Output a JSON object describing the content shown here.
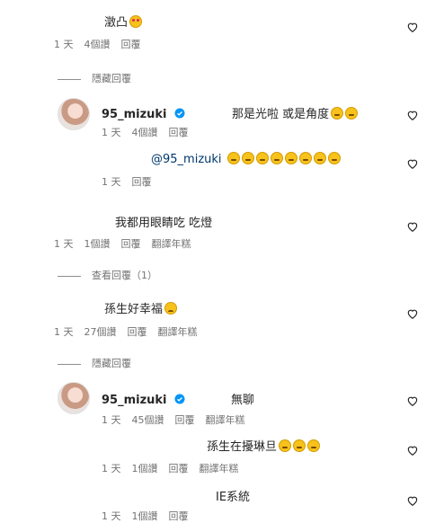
{
  "comments": [
    {
      "text": "澂凸",
      "time": "1 天",
      "likes": "4個讚",
      "reply": "回覆"
    },
    {
      "toggle": "隱藏回覆"
    },
    {
      "username": "95_mizuki",
      "text": "那是光啦 或是角度",
      "time": "1 天",
      "likes": "4個讚",
      "reply": "回覆"
    },
    {
      "mention": "@95_mizuki",
      "time": "1 天",
      "reply": "回覆"
    },
    {
      "text": "我都用眼睛吃 吃燈",
      "time": "1 天",
      "likes": "1個讚",
      "reply": "回覆",
      "translate": "翻譯年糕"
    },
    {
      "toggle": "查看回覆（1）"
    },
    {
      "text": "孫生好幸福",
      "time": "1 天",
      "likes": "27個讚",
      "reply": "回覆",
      "translate": "翻譯年糕"
    },
    {
      "toggle": "隱藏回覆"
    },
    {
      "username": "95_mizuki",
      "text": "無聊",
      "time": "1 天",
      "likes": "45個讚",
      "reply": "回覆",
      "translate": "翻譯年糕"
    },
    {
      "text": "孫生在擾琳旦",
      "time": "1 天",
      "likes": "1個讚",
      "reply": "回覆",
      "translate": "翻譯年糕"
    },
    {
      "text": "IE系統",
      "time": "1 天",
      "likes": "1個讚",
      "reply": "回覆"
    }
  ],
  "icons": {
    "like": "heart-outline-icon",
    "verified": "verified-badge-icon"
  },
  "colors": {
    "meta": "#737373",
    "verified": "#0095f6",
    "mention": "#00376b"
  }
}
